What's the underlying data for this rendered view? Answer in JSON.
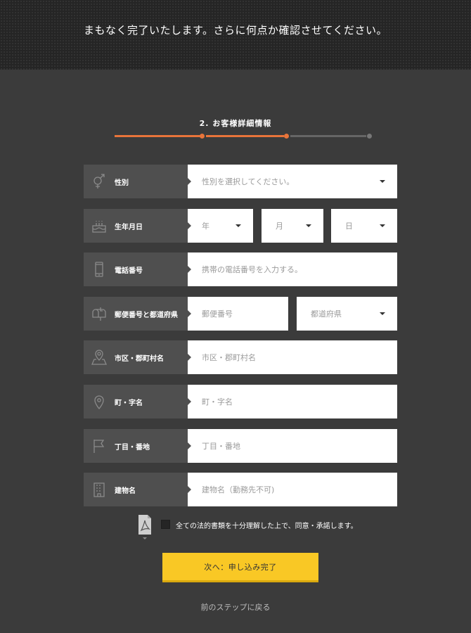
{
  "header": {
    "message": "まもなく完了いたします。さらに何点か確認させてください。"
  },
  "step": {
    "label": "2. お客様詳細情報",
    "active_color": "#e8743a",
    "inactive_color": "#666666"
  },
  "form": {
    "gender": {
      "label": "性別",
      "icon": "gender-icon",
      "placeholder": "性別を選択してください。"
    },
    "birthday": {
      "label": "生年月日",
      "icon": "cake-icon",
      "year": "年",
      "month": "月",
      "day": "日"
    },
    "phone": {
      "label": "電話番号",
      "icon": "mobile-phone-icon",
      "placeholder": "携帯の電話番号を入力する。"
    },
    "postal": {
      "label": "郵便番号と都道府県",
      "icon": "mailbox-icon",
      "postal_placeholder": "郵便番号",
      "prefecture_placeholder": "都道府県"
    },
    "city": {
      "label": "市区・郡町村名",
      "icon": "map-pin-icon",
      "placeholder": "市区・郡町村名"
    },
    "town": {
      "label": "町・字名",
      "icon": "location-pin-icon",
      "placeholder": "町・字名"
    },
    "block": {
      "label": "丁目・番地",
      "icon": "flag-icon",
      "placeholder": "丁目・番地"
    },
    "building": {
      "label": "建物名",
      "icon": "building-icon",
      "placeholder": "建物名（勤務先不可)"
    }
  },
  "agreement": {
    "text": "全ての法的書類を十分理解した上で、同意・承諾します。",
    "icon": "pdf-icon"
  },
  "actions": {
    "submit_label": "次へ：申し込み完了",
    "back_label": "前のステップに戻る",
    "submit_color": "#f9c825"
  }
}
